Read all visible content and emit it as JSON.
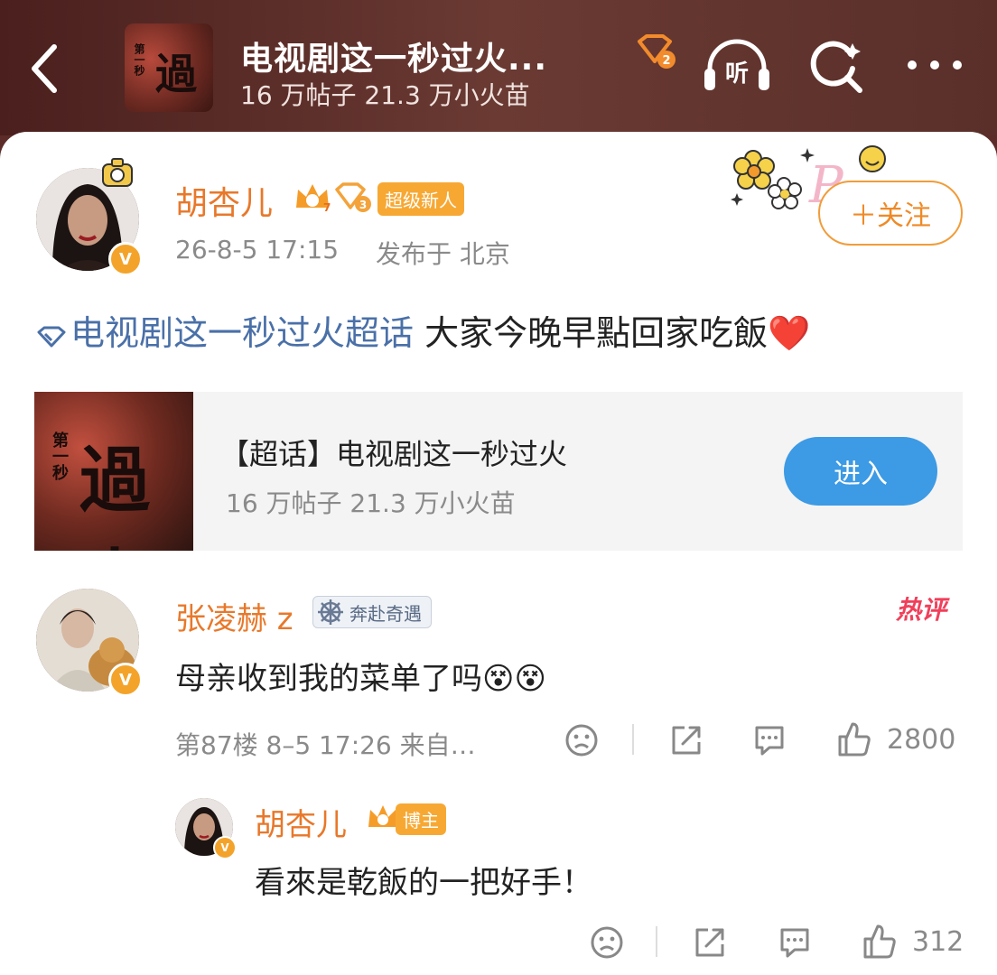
{
  "header": {
    "title": "电视剧这一秒过火...",
    "subtitle": "16 万帖子 21.3 万小火苗",
    "thumb_text_1": "過火",
    "thumb_text_2": "第一秒",
    "level_badge": "2",
    "listen_label": "听",
    "accent_color": "#f4a32a"
  },
  "post": {
    "author": "胡杏儿",
    "author_level": "7",
    "topic_level": "3",
    "tag": "超级新人",
    "verified_label": "V",
    "timestamp": "26-8-5 17:15",
    "location": "发布于 北京",
    "follow_label": "＋关注",
    "topic_link": "电视剧这一秒过火超话",
    "body": "大家今晚早點回家吃飯",
    "emoji": "❤️",
    "topic_card": {
      "title": "【超话】电视剧这一秒过火",
      "subtitle": "16 万帖子 21.3 万小火苗",
      "enter_label": "进入",
      "img_text_1": "過火",
      "img_text_2": "第一秒"
    }
  },
  "comment": {
    "author": "张凌赫 z",
    "medal": "奔赴奇遇",
    "hot_label": "热评",
    "verified_label": "V",
    "text": "母亲收到我的菜单了吗",
    "emoji": "😵😵",
    "meta": "第87楼 8–5 17:26 来自…",
    "like_count": "2800"
  },
  "reply": {
    "author": "胡杏儿",
    "role_tag": "博主",
    "verified_label": "V",
    "text": "看來是乾飯的一把好手！",
    "like_count": "312"
  },
  "icons": {
    "back": "back-arrow-icon",
    "listen": "headphones-icon",
    "search": "search-icon",
    "more": "more-dots-icon",
    "dislike": "frown-icon",
    "share": "share-icon",
    "comment": "comment-icon",
    "like": "thumbs-up-icon"
  }
}
